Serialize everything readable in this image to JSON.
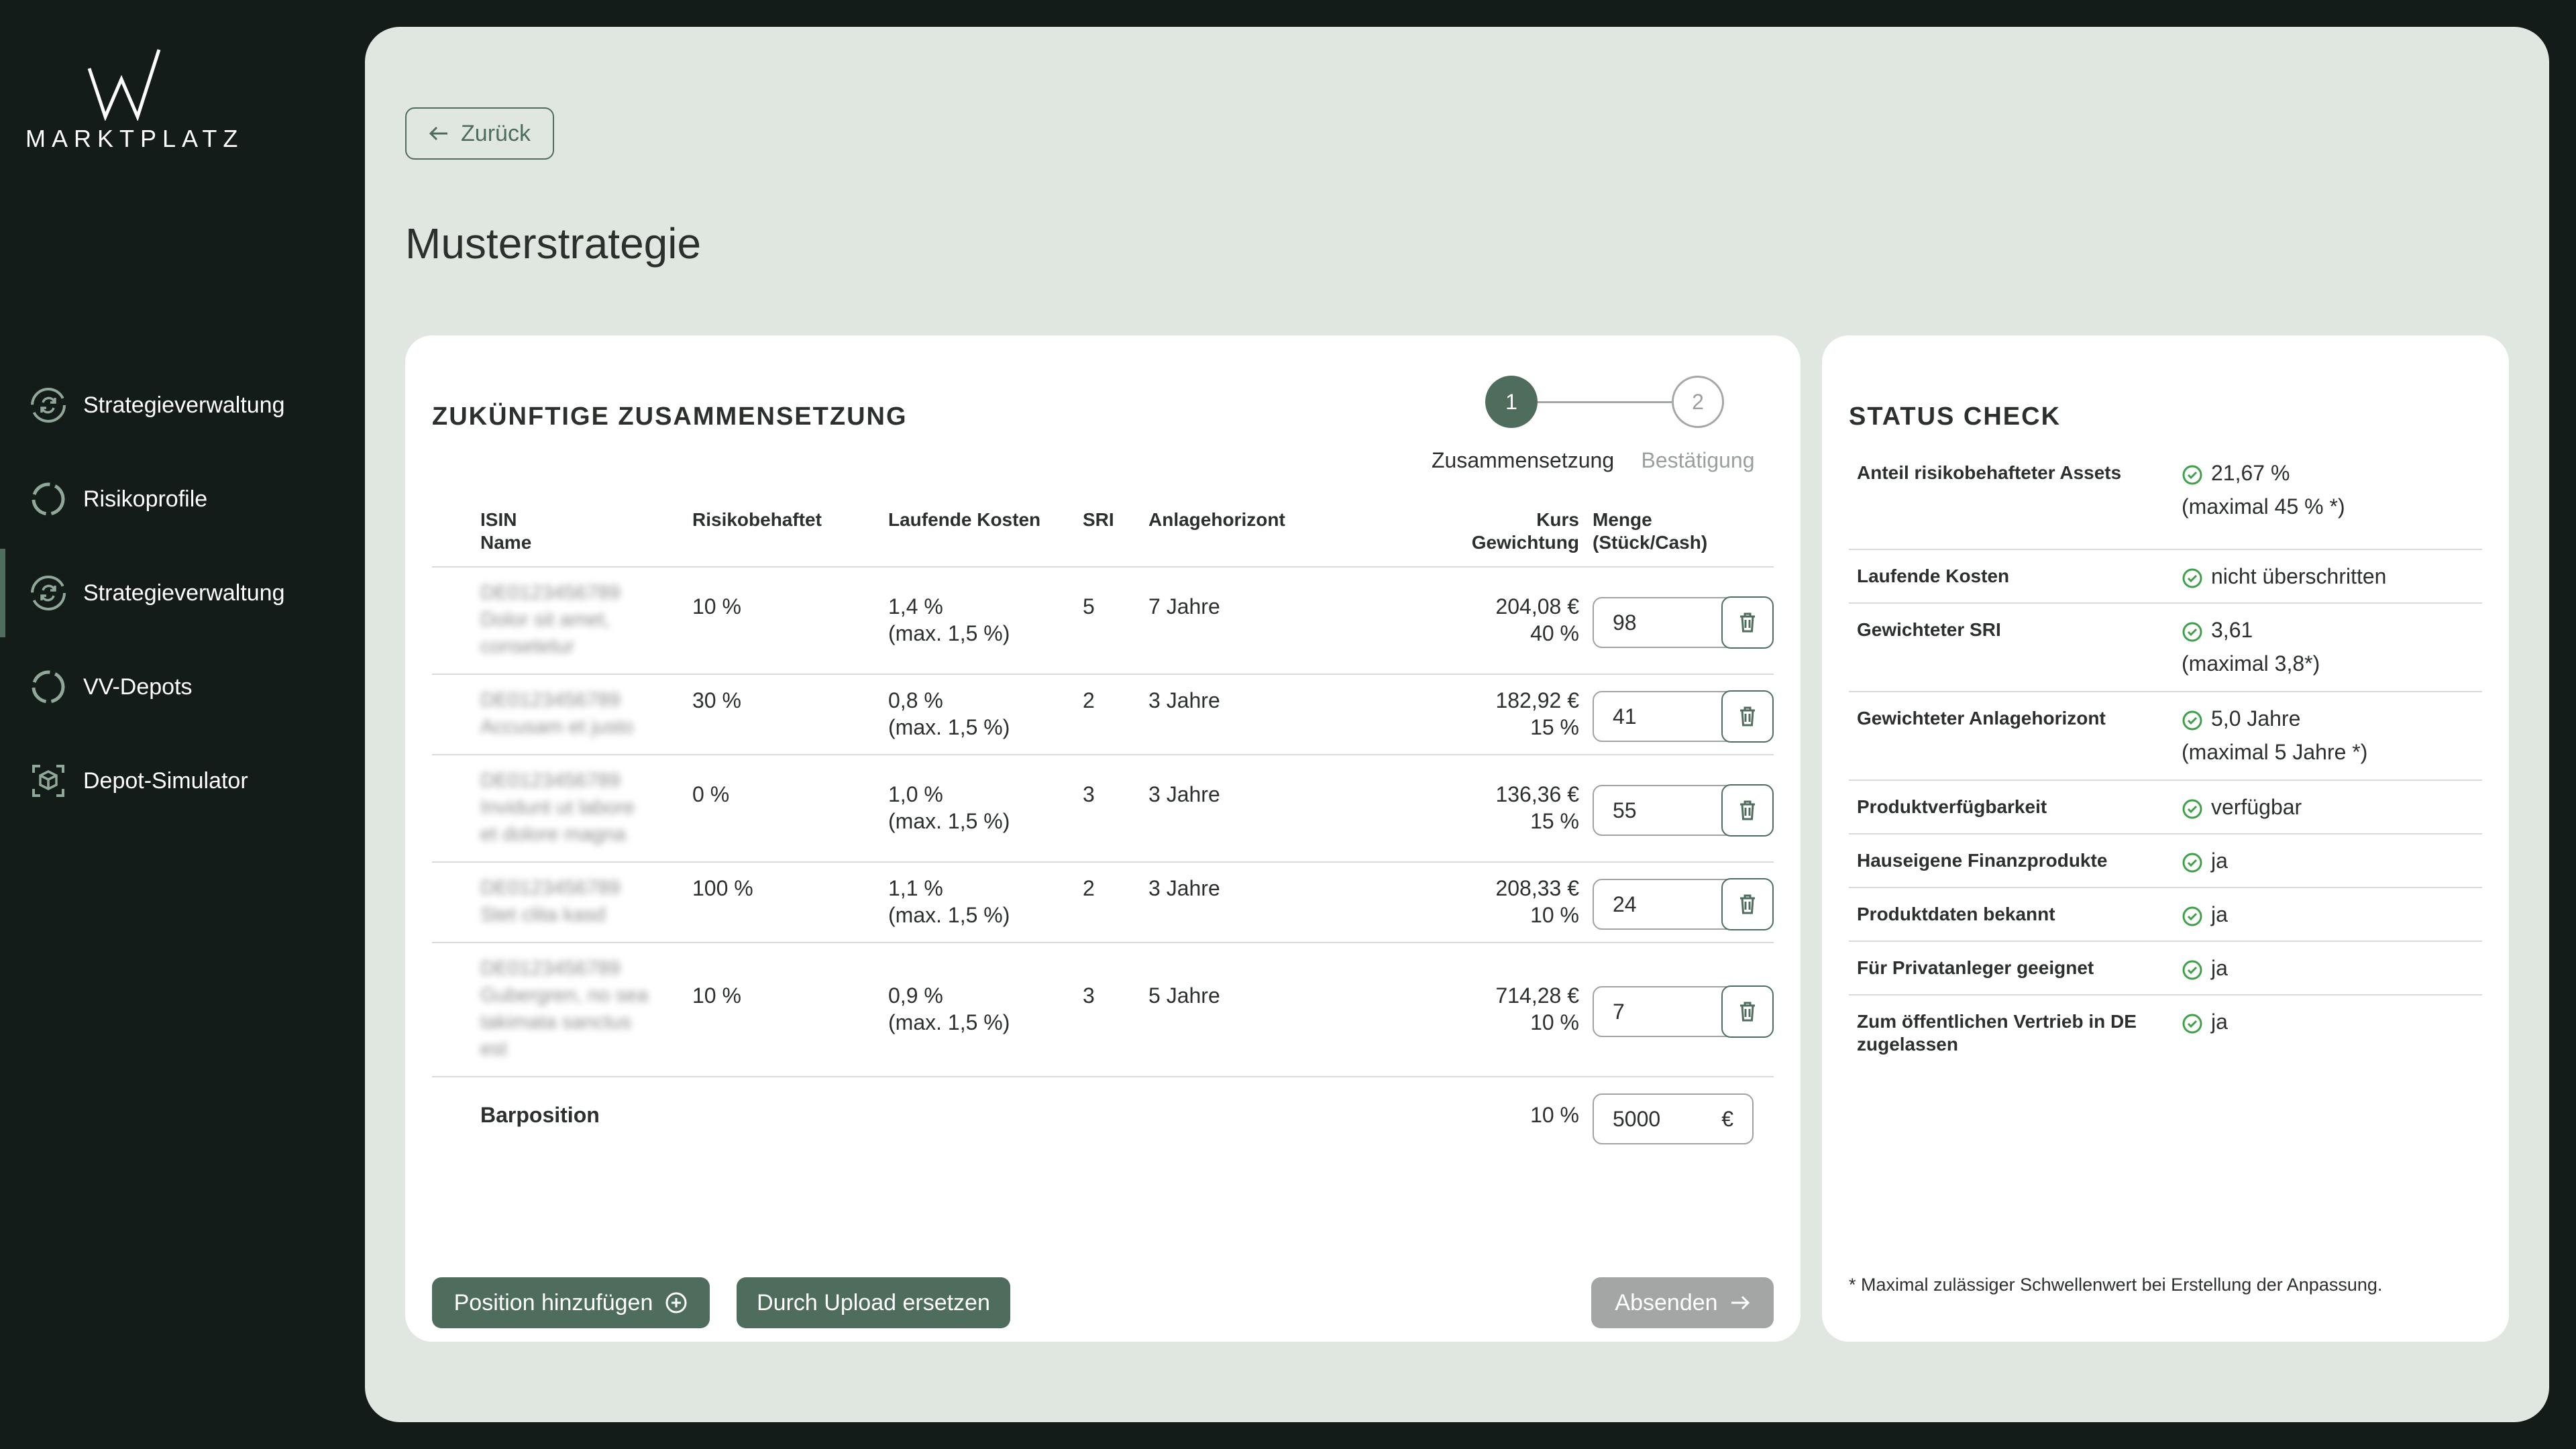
{
  "brand": {
    "name": "MARKTPLATZ"
  },
  "sidebar": {
    "items": [
      {
        "label": "Strategieverwaltung",
        "icon": "sync-circle-icon"
      },
      {
        "label": "Risikoprofile",
        "icon": "circle-progress-icon"
      },
      {
        "label": "Strategieverwaltung",
        "icon": "sync-circle-icon",
        "active": true
      },
      {
        "label": "VV-Depots",
        "icon": "circle-progress-icon"
      },
      {
        "label": "Depot-Simulator",
        "icon": "cube-scan-icon"
      }
    ]
  },
  "header": {
    "back_label": "Zurück",
    "title": "Musterstrategie"
  },
  "composition": {
    "title": "ZUKÜNFTIGE ZUSAMMENSETZUNG",
    "steps": [
      {
        "number": "1",
        "label": "Zusammensetzung"
      },
      {
        "number": "2",
        "label": "Bestätigung"
      }
    ],
    "columns": {
      "isin": "ISIN",
      "name": "Name",
      "risk": "Risikobehaftet",
      "costs": "Laufende Kosten",
      "sri": "SRI",
      "horizon": "Anlagehorizont",
      "kurs": "Kurs",
      "weight": "Gewichtung",
      "qty": "Menge",
      "qty_unit": "(Stück/Cash)"
    },
    "rows": [
      {
        "isin": "DE0123456789",
        "name_lines": [
          "Dolor sit amet,",
          "consetetur"
        ],
        "risk": "10 %",
        "cost": "1,4 %",
        "cost_max": "(max. 1,5 %)",
        "sri": "5",
        "horizon": "7 Jahre",
        "kurs": "204,08 €",
        "weight": "40 %",
        "qty": "98"
      },
      {
        "isin": "DE0123456789",
        "name_lines": [
          "Accusam et justo"
        ],
        "risk": "30 %",
        "cost": "0,8 %",
        "cost_max": "(max. 1,5 %)",
        "sri": "2",
        "horizon": "3 Jahre",
        "kurs": "182,92 €",
        "weight": "15 %",
        "qty": "41"
      },
      {
        "isin": "DE0123456789",
        "name_lines": [
          "Invidunt ut labore",
          "et dolore magna"
        ],
        "risk": "0 %",
        "cost": "1,0 %",
        "cost_max": "(max. 1,5 %)",
        "sri": "3",
        "horizon": "3 Jahre",
        "kurs": "136,36 €",
        "weight": "15 %",
        "qty": "55"
      },
      {
        "isin": "DE0123456789",
        "name_lines": [
          "Stet clita kasd"
        ],
        "risk": "100 %",
        "cost": "1,1 %",
        "cost_max": "(max. 1,5 %)",
        "sri": "2",
        "horizon": "3 Jahre",
        "kurs": "208,33 €",
        "weight": "10 %",
        "qty": "24"
      },
      {
        "isin": "DE0123456789",
        "name_lines": [
          "Gubergren, no sea",
          "takimata sanctus",
          "est"
        ],
        "risk": "10 %",
        "cost": "0,9 %",
        "cost_max": "(max. 1,5 %)",
        "sri": "3",
        "horizon": "5 Jahre",
        "kurs": "714,28 €",
        "weight": "10 %",
        "qty": "7"
      }
    ],
    "cash": {
      "label": "Barposition",
      "weight": "10 %",
      "amount": "5000",
      "currency": "€"
    },
    "buttons": {
      "add": "Position hinzufügen",
      "upload": "Durch Upload ersetzen",
      "submit": "Absenden"
    }
  },
  "status": {
    "title": "STATUS CHECK",
    "items": [
      {
        "label": "Anteil risikobehafteter Assets",
        "value": "21,67 %",
        "note": "(maximal 45 % *)"
      },
      {
        "label": "Laufende Kosten",
        "value": "nicht überschritten"
      },
      {
        "label": "Gewichteter SRI",
        "value": "3,61",
        "note": "(maximal 3,8*)"
      },
      {
        "label": "Gewichteter Anlagehorizont",
        "value": "5,0 Jahre",
        "note": "(maximal 5 Jahre *)"
      },
      {
        "label": "Produktverfügbarkeit",
        "value": "verfügbar"
      },
      {
        "label": "Hauseigene Finanzprodukte",
        "value": "ja"
      },
      {
        "label": "Produktdaten bekannt",
        "value": "ja"
      },
      {
        "label": "Für Privatanleger geeignet",
        "value": "ja"
      },
      {
        "label": "Zum öffentlichen Vertrieb in DE zugelassen",
        "value": "ja"
      }
    ],
    "footnote": "* Maximal zulässiger Schwellenwert bei Erstellung der Anpassung."
  }
}
